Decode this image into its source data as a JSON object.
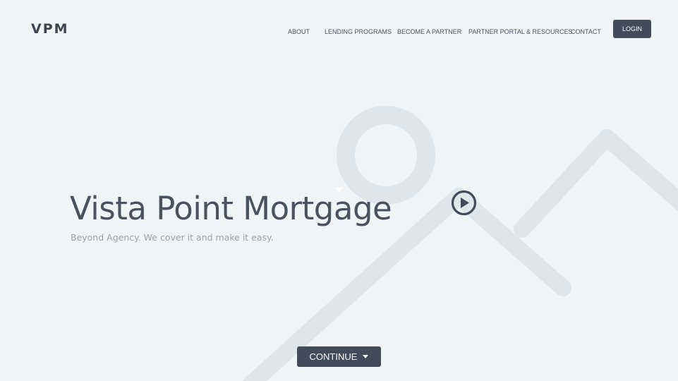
{
  "brand": {
    "logo_text": "VPM"
  },
  "nav": {
    "items": [
      {
        "label": "ABOUT"
      },
      {
        "label": "LENDING PROGRAMS"
      },
      {
        "label": "BECOME A PARTNER"
      },
      {
        "label": "PARTNER PORTAL & RESOURCES"
      },
      {
        "label": "CONTACT"
      }
    ],
    "login_label": "LOGIN"
  },
  "hero": {
    "title": "Vista Point Mortgage",
    "subtitle": "Beyond Agency. We cover it and make it easy.",
    "play_icon": "play-circle-icon",
    "continue_label": "CONTINUE",
    "continue_icon": "caret-down-icon"
  },
  "colors": {
    "background": "#f0f4f7",
    "accent": "#434a5c",
    "text_dark": "#4a5161",
    "text_muted": "#9ba1aa",
    "decor": "#dfe5e8"
  }
}
